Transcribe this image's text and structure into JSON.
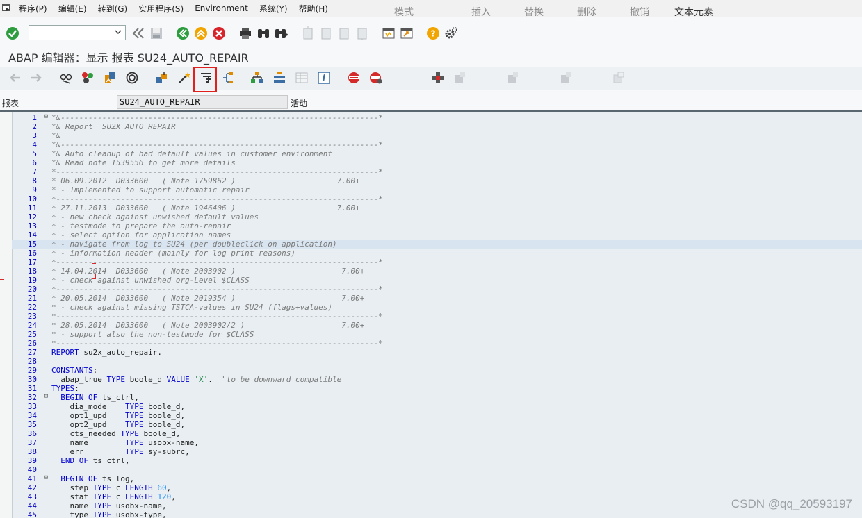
{
  "menu": {
    "items": [
      "程序(P)",
      "编辑(E)",
      "转到(G)",
      "实用程序(S)",
      "Environment",
      "系统(Y)",
      "帮助(H)"
    ]
  },
  "toolbar": {
    "command_value": "",
    "icons": [
      "enter-icon",
      "back-double-icon",
      "save-icon",
      "back-icon",
      "exit-icon",
      "cancel-icon",
      "print-icon",
      "find-icon",
      "find-next-icon",
      "first-page-icon",
      "prev-page-icon",
      "next-page-icon",
      "last-page-icon",
      "new-session-icon",
      "shortcut-icon",
      "help-icon",
      "settings-icon"
    ]
  },
  "title": "ABAP 编辑器：显示 报表 SU24_AUTO_REPAIR",
  "app_toolbar": {
    "mode_label": "模式",
    "insert_label": "插入",
    "replace_label": "替换",
    "delete_label": "删除",
    "undo_label": "撤销",
    "text_elements_label": "文本元素"
  },
  "field_row": {
    "label": "报表",
    "value": "SU24_AUTO_REPAIR",
    "status": "活动"
  },
  "code_lines": [
    {
      "n": "1",
      "t": "*&---------------------------------------------------------------------*",
      "c": true,
      "fold": "⊟"
    },
    {
      "n": "2",
      "t": "*& Report  SU2X_AUTO_REPAIR",
      "c": true
    },
    {
      "n": "3",
      "t": "*&",
      "c": true
    },
    {
      "n": "4",
      "t": "*&---------------------------------------------------------------------*",
      "c": true
    },
    {
      "n": "5",
      "t": "*& Auto cleanup of bad default values in customer environment",
      "c": true
    },
    {
      "n": "6",
      "t": "*& Read note 1539556 to get more details",
      "c": true
    },
    {
      "n": "7",
      "t": "*----------------------------------------------------------------------*",
      "c": true
    },
    {
      "n": "8",
      "t": "* 06.09.2012  D033600   ( Note 1759862 )                      7.00+",
      "c": true
    },
    {
      "n": "9",
      "t": "* - Implemented to support automatic repair",
      "c": true
    },
    {
      "n": "10",
      "t": "*----------------------------------------------------------------------*",
      "c": true
    },
    {
      "n": "11",
      "t": "* 27.11.2013  D033600   ( Note 1946406 )                      7.00+",
      "c": true
    },
    {
      "n": "12",
      "t": "* - new check against unwished default values",
      "c": true
    },
    {
      "n": "13",
      "t": "* - testmode to prepare the auto-repair",
      "c": true
    },
    {
      "n": "14",
      "t": "* - select option for application names",
      "c": true
    },
    {
      "n": "15",
      "t": "* - navigate from log to SU24 (per doubleclick on application)",
      "c": true,
      "cursor": true
    },
    {
      "n": "16",
      "t": "* - information header (mainly for log print reasons)",
      "c": true
    },
    {
      "n": "17",
      "t": "*----------------------------------------------------------------------*",
      "c": true
    },
    {
      "n": "18",
      "t": "* 14.04.2014  D033600   ( Note 2003902 )                       7.00+",
      "c": true
    },
    {
      "n": "19",
      "t": "* - check against unwished org-Level $CLASS",
      "c": true
    },
    {
      "n": "20",
      "t": "*----------------------------------------------------------------------*",
      "c": true
    },
    {
      "n": "21",
      "t": "* 20.05.2014  D033600   ( Note 2019354 )                       7.00+",
      "c": true
    },
    {
      "n": "22",
      "t": "* - check against missing TSTCA-values in SU24 (flags+values)",
      "c": true
    },
    {
      "n": "23",
      "t": "*----------------------------------------------------------------------*",
      "c": true
    },
    {
      "n": "24",
      "t": "* 28.05.2014  D033600   ( Note 2003902/2 )                     7.00+",
      "c": true
    },
    {
      "n": "25",
      "t": "* - support also the non-testmode for $CLASS",
      "c": true
    },
    {
      "n": "26",
      "t": "*----------------------------------------------------------------------*",
      "c": true
    },
    {
      "n": "27",
      "h": "<span class=\"kw\">REPORT</span> su2x_auto_repair."
    },
    {
      "n": "28",
      "t": ""
    },
    {
      "n": "29",
      "h": "<span class=\"kw\">CONSTANTS</span>:"
    },
    {
      "n": "30",
      "h": "  abap_true <span class=\"kw\">TYPE</span> boole_d <span class=\"kw\">VALUE</span> <span class=\"str\">'X'</span>.  <span class=\"cmt\">\"to be downward compatible</span>"
    },
    {
      "n": "31",
      "h": "<span class=\"kw\">TYPES</span>:"
    },
    {
      "n": "32",
      "h": "  <span class=\"kw\">BEGIN OF</span> ts_ctrl,",
      "fold": "⊟"
    },
    {
      "n": "33",
      "h": "    dia_mode    <span class=\"kw\">TYPE</span> boole_d,"
    },
    {
      "n": "34",
      "h": "    opt1_upd    <span class=\"kw\">TYPE</span> boole_d,"
    },
    {
      "n": "35",
      "h": "    opt2_upd    <span class=\"kw\">TYPE</span> boole_d,"
    },
    {
      "n": "36",
      "h": "    cts_needed <span class=\"kw\">TYPE</span> boole_d,"
    },
    {
      "n": "37",
      "h": "    name        <span class=\"kw\">TYPE</span> usobx-name,"
    },
    {
      "n": "38",
      "h": "    err         <span class=\"kw\">TYPE</span> sy-subrc,"
    },
    {
      "n": "39",
      "h": "  <span class=\"kw\">END OF</span> ts_ctrl,"
    },
    {
      "n": "40",
      "t": ""
    },
    {
      "n": "41",
      "h": "  <span class=\"kw\">BEGIN OF</span> ts_log,",
      "fold": "⊟"
    },
    {
      "n": "42",
      "h": "    step <span class=\"kw\">TYPE</span> c <span class=\"kw\">LENGTH</span> <span class=\"num-lit\">60</span>,"
    },
    {
      "n": "43",
      "h": "    stat <span class=\"kw\">TYPE</span> c <span class=\"kw\">LENGTH</span> <span class=\"num-lit\">120</span>,"
    },
    {
      "n": "44",
      "h": "    name <span class=\"kw\">TYPE</span> usobx-name,"
    },
    {
      "n": "45",
      "h": "    type <span class=\"kw\">TYPE</span> usobx-type,"
    }
  ],
  "watermark": "CSDN @qq_20593197"
}
